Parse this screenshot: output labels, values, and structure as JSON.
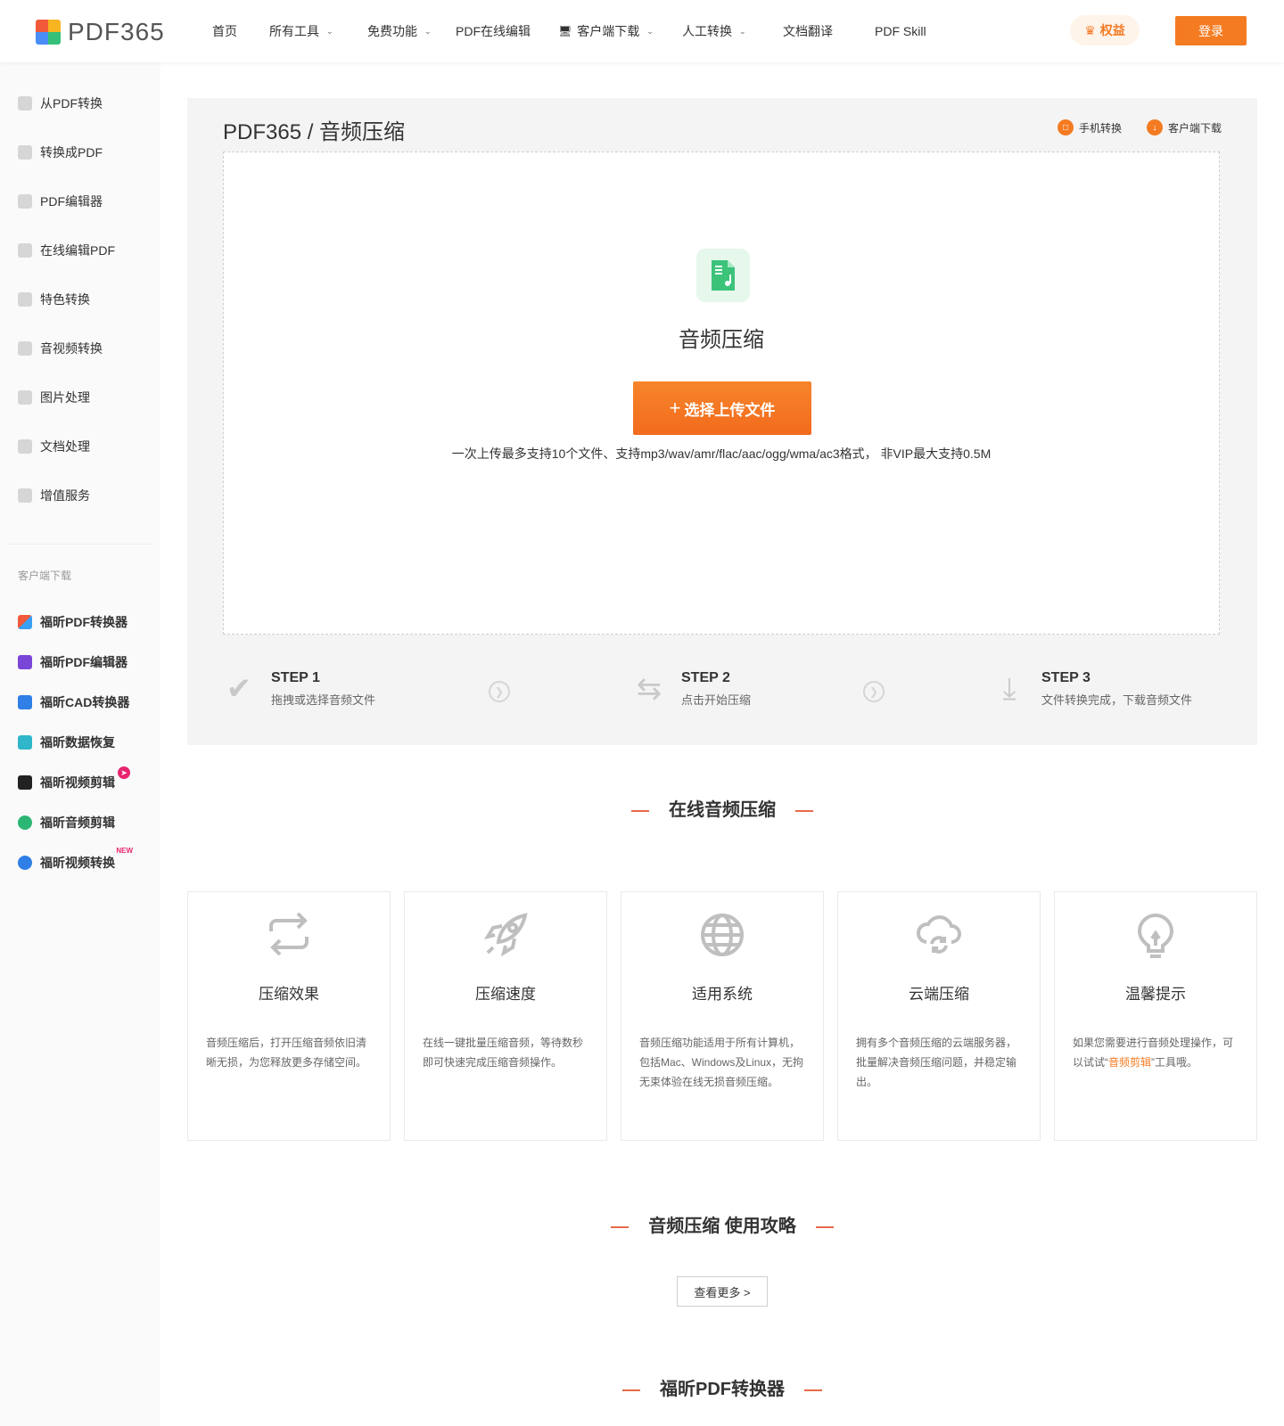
{
  "header": {
    "logo_text": "PDF365",
    "nav": [
      {
        "label": "首页",
        "dropdown": false,
        "monitor": false
      },
      {
        "label": "所有工具",
        "dropdown": true,
        "monitor": false
      },
      {
        "label": "免费功能",
        "dropdown": true,
        "monitor": false
      },
      {
        "label": "PDF在线编辑",
        "dropdown": false,
        "monitor": false
      },
      {
        "label": "客户端下载",
        "dropdown": true,
        "monitor": true
      },
      {
        "label": "人工转换",
        "dropdown": true,
        "monitor": false
      },
      {
        "label": "文档翻译",
        "dropdown": false,
        "monitor": false
      },
      {
        "label": "PDF Skill",
        "dropdown": false,
        "monitor": false
      }
    ],
    "benefits_label": "权益",
    "login_label": "登录"
  },
  "sidebar": {
    "items": [
      {
        "label": "从PDF转换",
        "icon": "pdf-convert-icon"
      },
      {
        "label": "转换成PDF",
        "icon": "to-pdf-icon"
      },
      {
        "label": "PDF编辑器",
        "icon": "pdf-editor-icon"
      },
      {
        "label": "在线编辑PDF",
        "icon": "online-edit-icon"
      },
      {
        "label": "特色转换",
        "icon": "special-convert-icon"
      },
      {
        "label": "音视频转换",
        "icon": "av-convert-icon"
      },
      {
        "label": "图片处理",
        "icon": "image-process-icon"
      },
      {
        "label": "文档处理",
        "icon": "document-process-icon"
      },
      {
        "label": "增值服务",
        "icon": "value-added-icon"
      }
    ],
    "download_heading": "客户端下载",
    "apps": [
      {
        "label": "福昕PDF转换器",
        "color": "#3aa0f3",
        "badge": ""
      },
      {
        "label": "福昕PDF编辑器",
        "color": "#7a46d8",
        "badge": ""
      },
      {
        "label": "福昕CAD转换器",
        "color": "#2f7fe6",
        "badge": ""
      },
      {
        "label": "福昕数据恢复",
        "color": "#2fb7c9",
        "badge": ""
      },
      {
        "label": "福昕视频剪辑",
        "color": "#f07a1a",
        "badge": "hot"
      },
      {
        "label": "福昕音频剪辑",
        "color": "#2bb673",
        "badge": ""
      },
      {
        "label": "福昕视频转换",
        "color": "#2f7fe6",
        "badge": "NEW"
      }
    ]
  },
  "panel": {
    "title": "PDF365 / 音频压缩",
    "mobile_link": "手机转换",
    "client_link": "客户端下载",
    "tool_name": "音频压缩",
    "upload_label": "选择上传文件",
    "upload_tip": "一次上传最多支持10个文件、支持mp3/wav/amr/flac/aac/ogg/wma/ac3格式， 非VIP最大支持0.5M",
    "steps": [
      {
        "title": "STEP 1",
        "desc": "拖拽或选择音频文件",
        "icon": "check-icon"
      },
      {
        "title": "STEP 2",
        "desc": "点击开始压缩",
        "icon": "swap-icon"
      },
      {
        "title": "STEP 3",
        "desc": "文件转换完成，下载音频文件",
        "icon": "download-icon"
      }
    ]
  },
  "sections": {
    "online": "在线音频压缩",
    "guide": "音频压缩 使用攻略",
    "more_label": "查看更多 >",
    "converter": "福昕PDF转换器"
  },
  "cards": [
    {
      "title": "压缩效果",
      "desc": "音频压缩后，打开压缩音频依旧清晰无损，为您释放更多存储空间。",
      "icon": "repeat-icon"
    },
    {
      "title": "压缩速度",
      "desc": "在线一键批量压缩音频，等待数秒即可快速完成压缩音频操作。",
      "icon": "rocket-icon"
    },
    {
      "title": "适用系统",
      "desc": "音频压缩功能适用于所有计算机，包括Mac、Windows及Linux，无拘无束体验在线无损音频压缩。",
      "icon": "globe-icon"
    },
    {
      "title": "云端压缩",
      "desc": "拥有多个音频压缩的云端服务器，批量解决音频压缩问题，并稳定输出。",
      "icon": "cloud-sync-icon"
    },
    {
      "title": "温馨提示",
      "desc_pre": "如果您需要进行音频处理操作，可以试试“",
      "desc_link": "音频剪辑",
      "desc_post": "”工具哦。",
      "icon": "lightbulb-icon"
    }
  ]
}
